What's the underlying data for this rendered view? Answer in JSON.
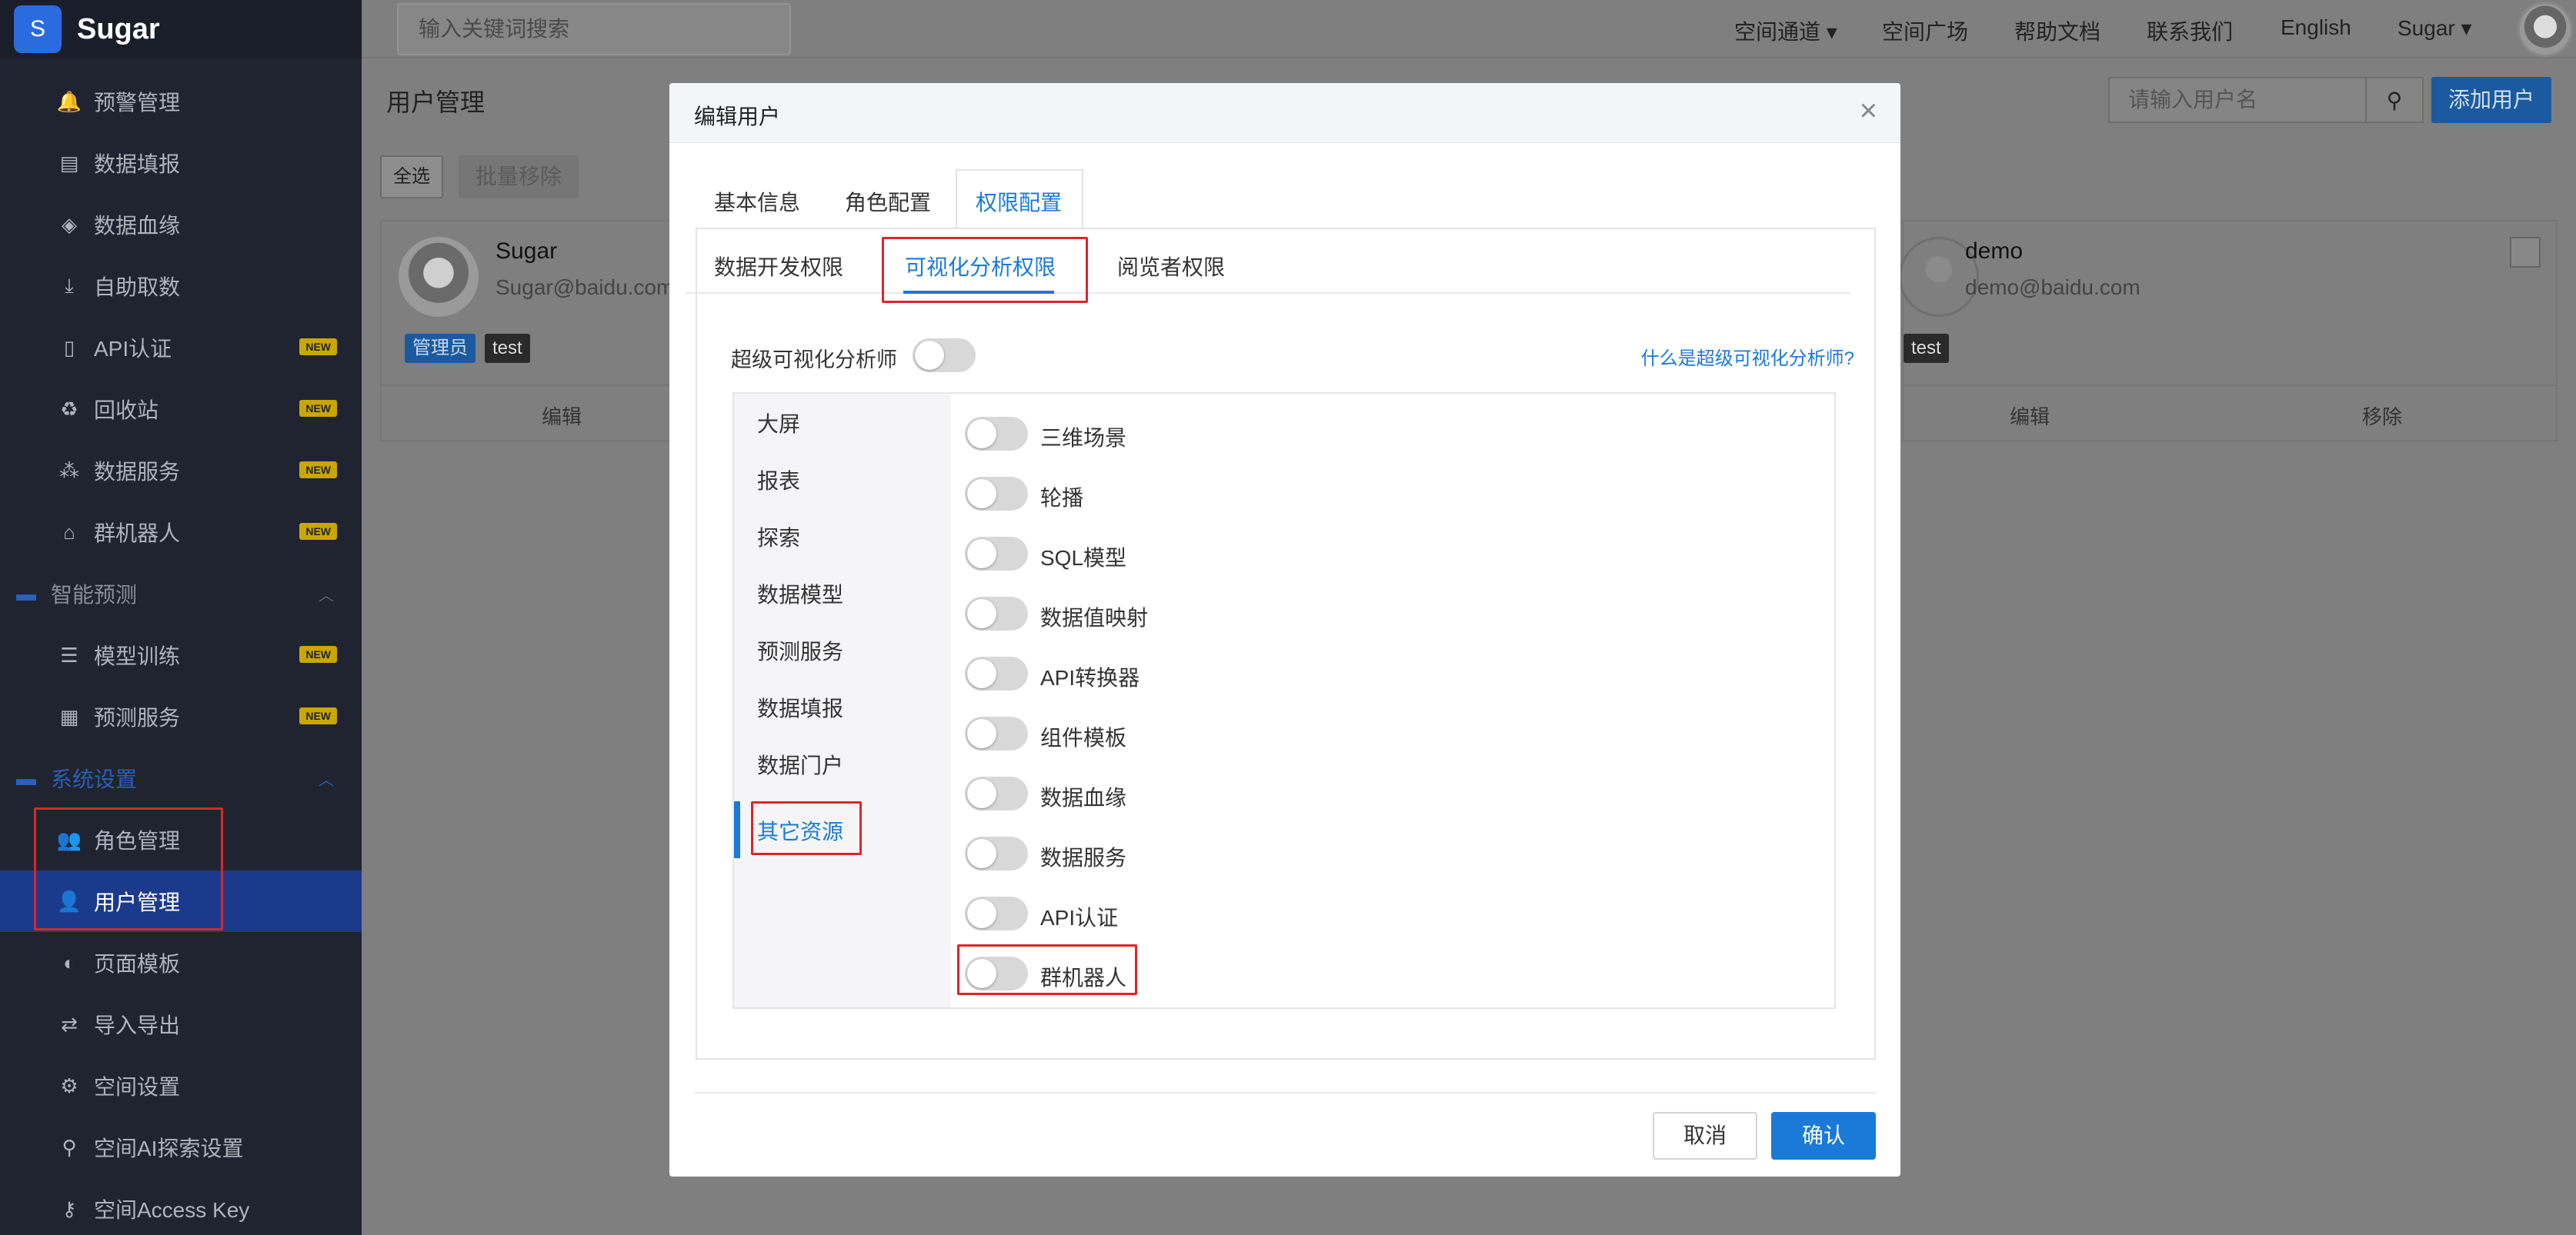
{
  "brand": {
    "logo_letter": "S",
    "name": "Sugar"
  },
  "sidebar": {
    "items": [
      {
        "label": "预警管理",
        "icon": "bell-icon",
        "new": false
      },
      {
        "label": "数据填报",
        "icon": "id-card-icon",
        "new": false
      },
      {
        "label": "数据血缘",
        "icon": "layers-icon",
        "new": false
      },
      {
        "label": "自助取数",
        "icon": "download-icon",
        "new": false
      },
      {
        "label": "API认证",
        "icon": "document-icon",
        "new": true
      },
      {
        "label": "回收站",
        "icon": "recycle-icon",
        "new": true
      },
      {
        "label": "数据服务",
        "icon": "network-icon",
        "new": true
      },
      {
        "label": "群机器人",
        "icon": "robot-icon",
        "new": true
      },
      {
        "label": "智能预测",
        "icon": "folder-icon",
        "new": false,
        "group": true
      },
      {
        "label": "模型训练",
        "icon": "database-icon",
        "new": true
      },
      {
        "label": "预测服务",
        "icon": "server-icon",
        "new": true
      },
      {
        "label": "系统设置",
        "icon": "folder-icon",
        "new": false,
        "group": true
      },
      {
        "label": "角色管理",
        "icon": "users-icon",
        "new": false
      },
      {
        "label": "用户管理",
        "icon": "user-icon",
        "new": false,
        "active": true
      },
      {
        "label": "页面模板",
        "icon": "palette-icon",
        "new": false
      },
      {
        "label": "导入导出",
        "icon": "swap-icon",
        "new": false
      },
      {
        "label": "空间设置",
        "icon": "gear-icon",
        "new": false
      },
      {
        "label": "空间AI探索设置",
        "icon": "search-icon",
        "new": false
      },
      {
        "label": "空间Access Key",
        "icon": "key-icon",
        "new": false
      }
    ],
    "new_badge": "NEW"
  },
  "topbar": {
    "search_placeholder": "输入关键词搜索",
    "links": [
      "空间通道",
      "空间广场",
      "帮助文档",
      "联系我们",
      "English",
      "Sugar"
    ]
  },
  "page": {
    "title": "用户管理",
    "search_placeholder": "请输入用户名",
    "add_user": "添加用户",
    "select_all": "全选",
    "bulk_remove": "批量移除",
    "cards": [
      {
        "name": "Sugar",
        "email": "Sugar@baidu.com",
        "tags": [
          "管理员",
          "test"
        ],
        "actions": [
          "编辑"
        ]
      },
      {
        "name": "demo",
        "email": "demo@baidu.com",
        "tags": [
          "test"
        ],
        "actions": [
          "编辑",
          "移除"
        ]
      }
    ]
  },
  "modal": {
    "title": "编辑用户",
    "tabs": [
      "基本信息",
      "角色配置",
      "权限配置"
    ],
    "active_tab": "权限配置",
    "subtabs": [
      "数据开发权限",
      "可视化分析权限",
      "阅览者权限"
    ],
    "active_subtab": "可视化分析权限",
    "super_analyst_label": "超级可视化分析师",
    "help_link": "什么是超级可视化分析师?",
    "categories": [
      "大屏",
      "报表",
      "探索",
      "数据模型",
      "预测服务",
      "数据填报",
      "数据门户",
      "其它资源"
    ],
    "active_category": "其它资源",
    "permissions": [
      "三维场景",
      "轮播",
      "SQL模型",
      "数据值映射",
      "API转换器",
      "组件模板",
      "数据血缘",
      "数据服务",
      "API认证",
      "群机器人"
    ],
    "cancel": "取消",
    "confirm": "确认"
  },
  "colors": {
    "accent": "#1a7ad8",
    "highlight_box": "#e0232a",
    "sidebar_bg": "#1f2430"
  }
}
